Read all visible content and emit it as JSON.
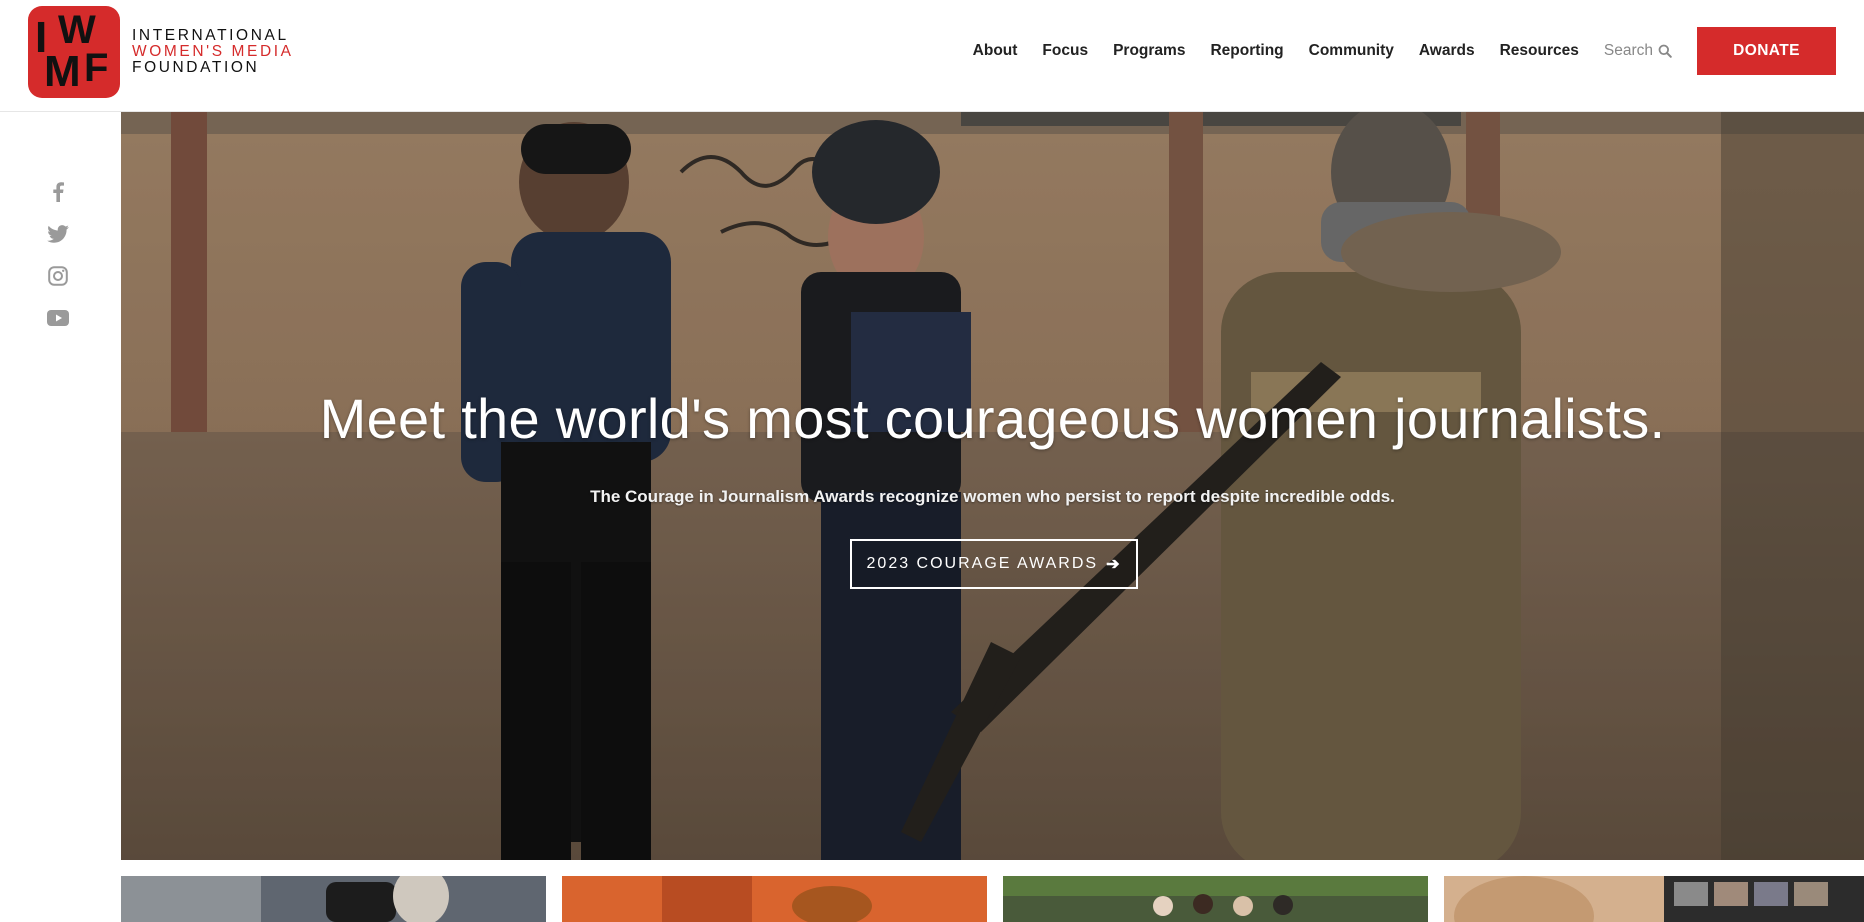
{
  "brand": {
    "line1": "INTERNATIONAL",
    "line2": "WOMEN'S MEDIA",
    "line3": "FOUNDATION",
    "mark_letters": [
      "I",
      "W",
      "M",
      "F"
    ],
    "primary_color": "#d52b2b"
  },
  "nav": {
    "items": [
      {
        "label": "About"
      },
      {
        "label": "Focus"
      },
      {
        "label": "Programs"
      },
      {
        "label": "Reporting"
      },
      {
        "label": "Community"
      },
      {
        "label": "Awards"
      },
      {
        "label": "Resources"
      }
    ],
    "search_label": "Search",
    "donate_label": "DONATE"
  },
  "social": {
    "icons": [
      "facebook-icon",
      "twitter-icon",
      "instagram-icon",
      "youtube-icon"
    ],
    "icon_color": "#9a9a9a"
  },
  "hero": {
    "title": "Meet the world's most courageous women journalists.",
    "subtitle": "The Courage in Journalism Awards recognize women who persist to report despite incredible odds.",
    "button_label": "2023 COURAGE AWARDS",
    "button_icon": "arrow-right-icon"
  },
  "cards": {
    "count_visible": 4
  }
}
